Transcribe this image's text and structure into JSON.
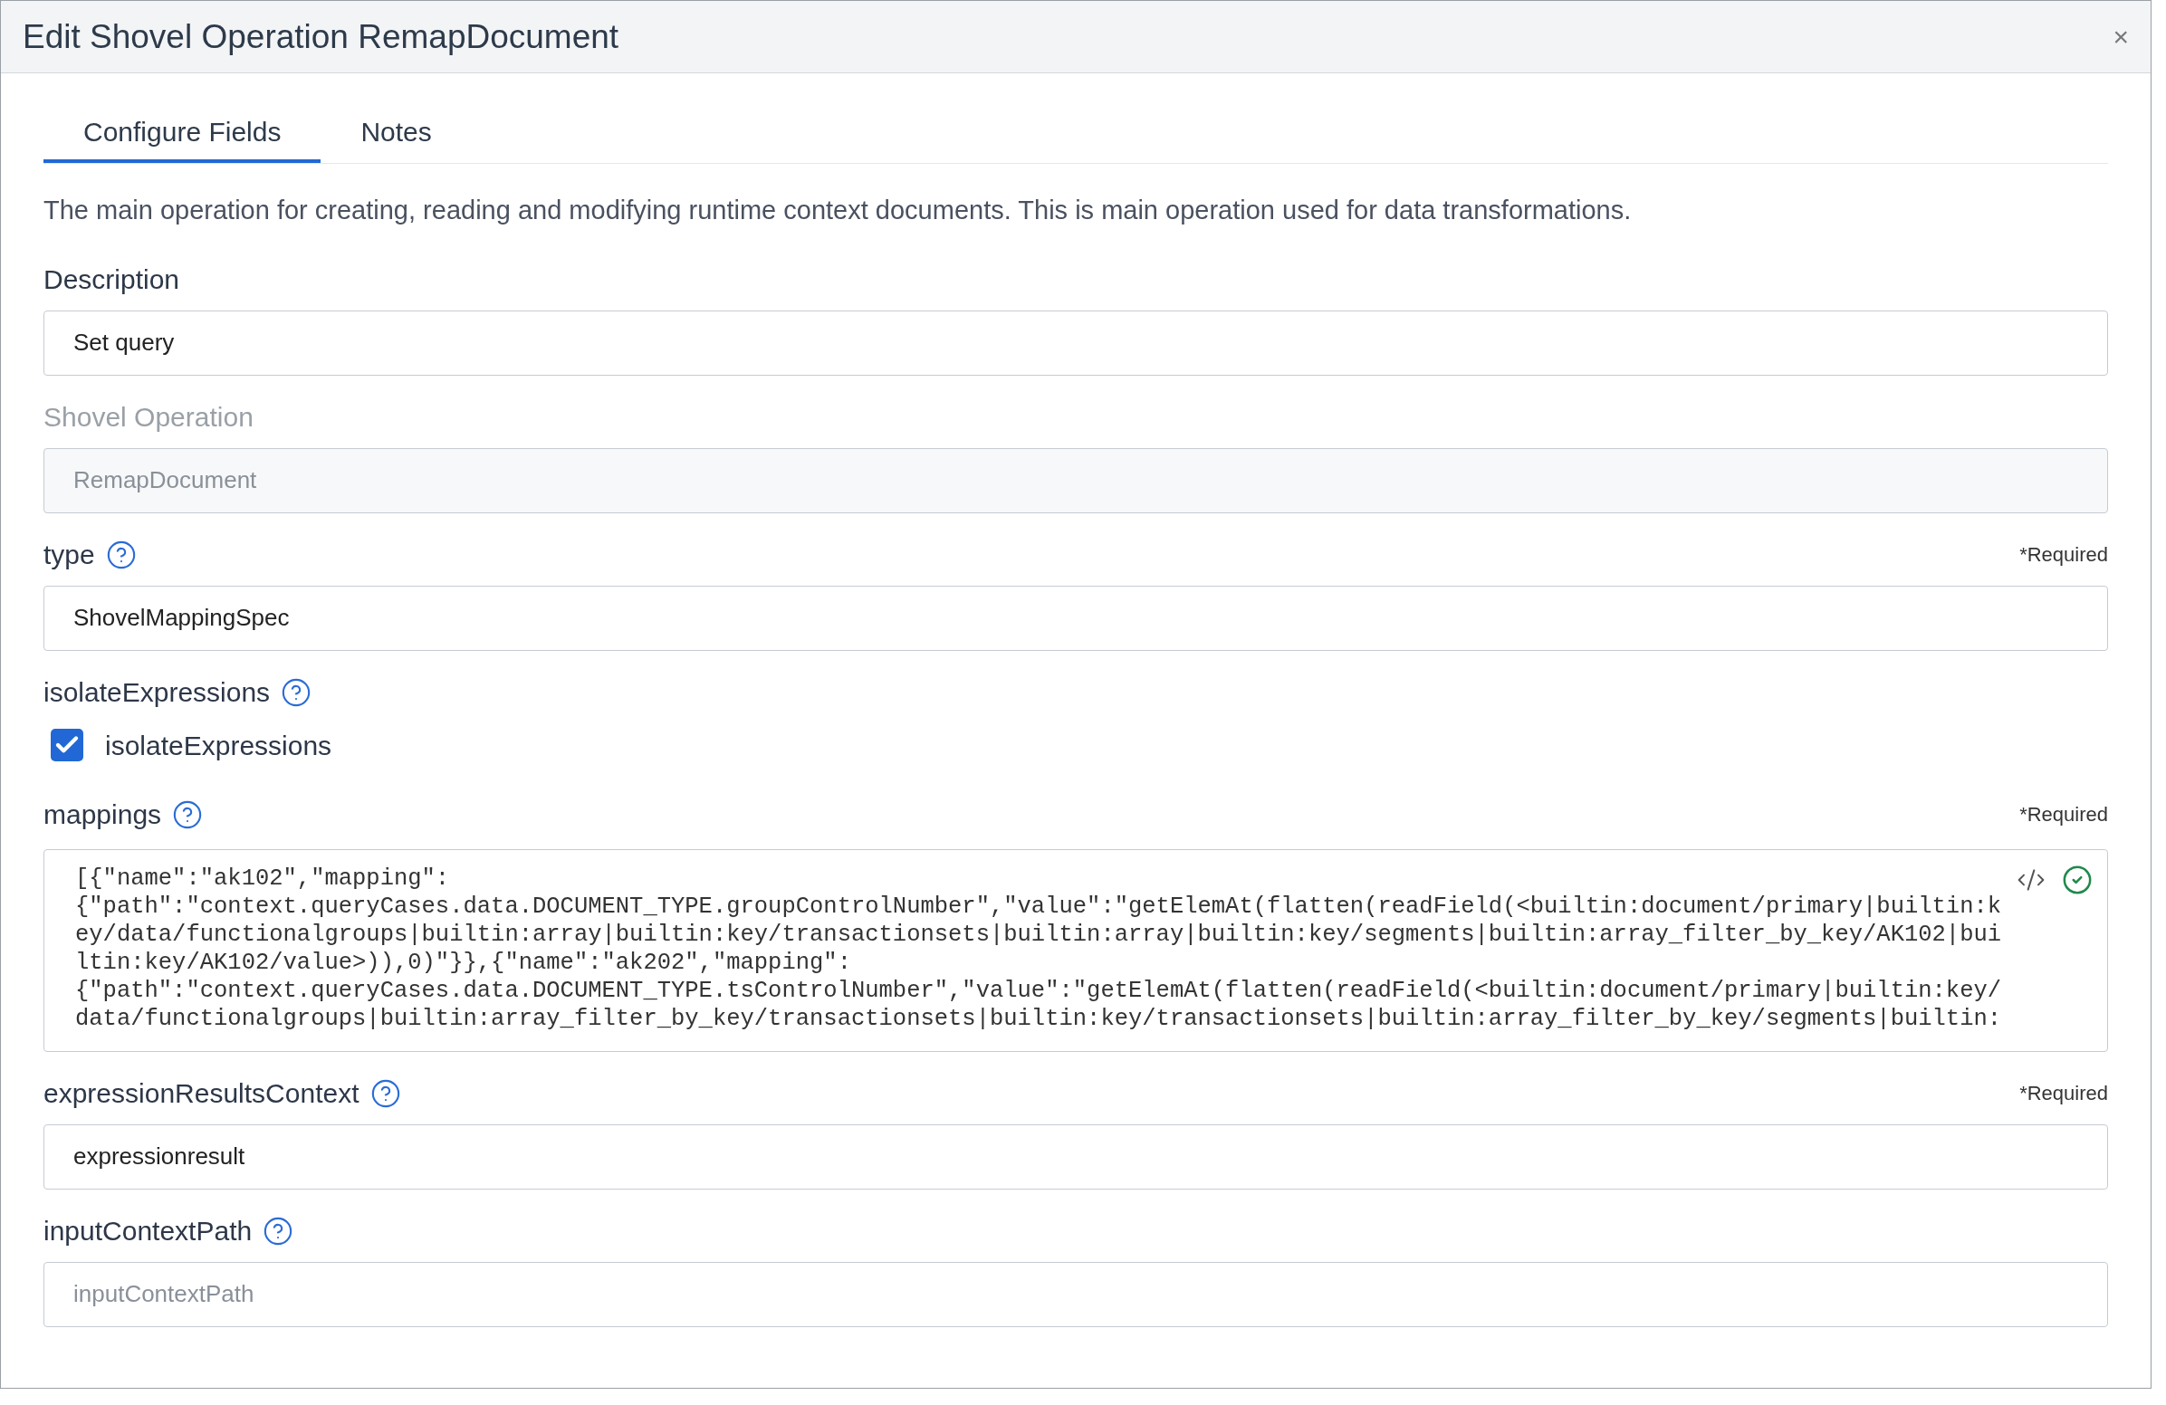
{
  "dialog": {
    "title": "Edit Shovel Operation RemapDocument",
    "close": "×"
  },
  "tabs": [
    {
      "label": "Configure Fields",
      "selected": true
    },
    {
      "label": "Notes",
      "selected": false
    }
  ],
  "intro": "The main operation for creating, reading and modifying runtime context documents. This is main operation used for data transformations.",
  "fields": [
    {
      "kind": "text",
      "label": "Description",
      "help": false,
      "value": "Set query",
      "disabled": false
    },
    {
      "kind": "text",
      "label": "Shovel Operation",
      "help": false,
      "value": "RemapDocument",
      "disabled": true
    },
    {
      "kind": "text",
      "label": "type",
      "help": true,
      "required": "*Required",
      "value": "ShovelMappingSpec",
      "disabled": false
    },
    {
      "kind": "checkbox",
      "label": "isolateExpressions",
      "help": true,
      "checkbox_label": "isolateExpressions",
      "checked": true
    },
    {
      "kind": "code",
      "label": "mappings",
      "help": true,
      "required": "*Required",
      "valid": true,
      "lines": [
        "[{\"name\":\"ak102\",\"mapping\":",
        "{\"path\":\"context.queryCases.data.DOCUMENT_TYPE.groupControlNumber\",\"value\":\"getElemAt(flatten(readField(<builtin:document/primary|builtin:k",
        "ey/data/functionalgroups|builtin:array|builtin:key/transactionsets|builtin:array|builtin:key/segments|builtin:array_filter_by_key/AK102|bui",
        "ltin:key/AK102/value>)),0)\"}},{\"name\":\"ak202\",\"mapping\":",
        "{\"path\":\"context.queryCases.data.DOCUMENT_TYPE.tsControlNumber\",\"value\":\"getElemAt(flatten(readField(<builtin:document/primary|builtin:key/",
        "data/functionalgroups|builtin:array_filter_by_key/transactionsets|builtin:key/transactionsets|builtin:array_filter_by_key/segments|builtin:"
      ]
    },
    {
      "kind": "text",
      "label": "expressionResultsContext",
      "help": true,
      "required": "*Required",
      "value": "expressionresult",
      "disabled": false
    },
    {
      "kind": "text",
      "label": "inputContextPath",
      "help": true,
      "placeholder": "inputContextPath",
      "disabled": false
    }
  ]
}
